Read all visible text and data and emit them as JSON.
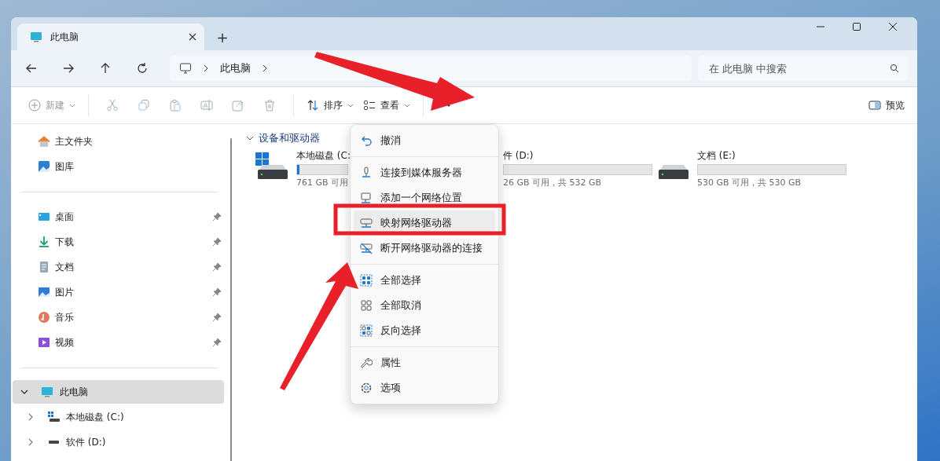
{
  "tab": {
    "title": "此电脑",
    "new_tab": "+"
  },
  "address": {
    "crumbs": [
      "此电脑"
    ]
  },
  "search": {
    "placeholder": "在 此电脑 中搜索"
  },
  "toolbar": {
    "new": {
      "label": "新建",
      "disabled": true
    },
    "sort": "排序",
    "view": "查看",
    "preview": "预览"
  },
  "sidebar": {
    "top": [
      {
        "label": "主文件夹",
        "kind": "home"
      },
      {
        "label": "图库",
        "kind": "gallery"
      }
    ],
    "pinned": [
      {
        "label": "桌面",
        "kind": "desktop"
      },
      {
        "label": "下载",
        "kind": "download"
      },
      {
        "label": "文档",
        "kind": "docs"
      },
      {
        "label": "图片",
        "kind": "pictures"
      },
      {
        "label": "音乐",
        "kind": "music"
      },
      {
        "label": "视频",
        "kind": "video"
      }
    ],
    "tree": [
      {
        "label": "此电脑",
        "kind": "pc",
        "selected": true,
        "expanded": true,
        "children": [
          {
            "label": "本地磁盘 (C:)",
            "kind": "sysdisk",
            "selected": false,
            "expanded": false
          },
          {
            "label": "软件 (D:)",
            "kind": "disk",
            "selected": false,
            "expanded": false
          }
        ]
      }
    ]
  },
  "group": {
    "title": "设备和驱动器",
    "expanded": true
  },
  "drives": [
    {
      "kind": "system",
      "name": "本地磁盘 (C:",
      "free": "761 GB 可用",
      "level": 0.05
    },
    {
      "kind": "covered",
      "name": "件 (D:)",
      "free": "26 GB 可用，共 532 GB"
    },
    {
      "kind": "disk",
      "name": "文档 (E:)",
      "free": "530 GB 可用，共 530 GB"
    }
  ],
  "menu": [
    [
      {
        "label": "撤消",
        "kind": "undo",
        "selected": false
      }
    ],
    [
      {
        "label": "连接到媒体服务器",
        "kind": "media",
        "selected": false
      },
      {
        "label": "添加一个网络位置",
        "kind": "netloc",
        "selected": false
      },
      {
        "label": "映射网络驱动器",
        "kind": "mapdrive",
        "selected": true
      },
      {
        "label": "断开网络驱动器的连接",
        "kind": "disconnect",
        "selected": false
      }
    ],
    [
      {
        "label": "全部选择",
        "kind": "selall",
        "selected": false
      },
      {
        "label": "全部取消",
        "kind": "selnone",
        "selected": false
      },
      {
        "label": "反向选择",
        "kind": "invert",
        "selected": false
      }
    ],
    [
      {
        "label": "属性",
        "kind": "props",
        "selected": false
      },
      {
        "label": "选项",
        "kind": "options",
        "selected": false
      }
    ]
  ]
}
